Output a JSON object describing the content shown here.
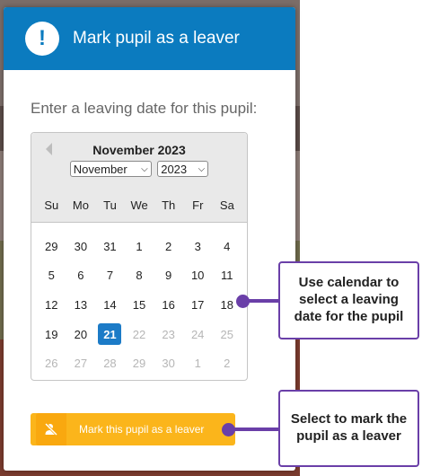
{
  "modal": {
    "title": "Mark pupil as a leaver",
    "alert_icon_glyph": "!",
    "prompt": "Enter a leaving date for this pupil:"
  },
  "datepicker": {
    "title": "November 2023",
    "prev_icon": "chevron-left-icon",
    "month_select": "November",
    "year_select": "2023",
    "weekdays": [
      "Su",
      "Mo",
      "Tu",
      "We",
      "Th",
      "Fr",
      "Sa"
    ],
    "weeks": [
      [
        {
          "d": "29"
        },
        {
          "d": "30"
        },
        {
          "d": "31"
        },
        {
          "d": "1"
        },
        {
          "d": "2"
        },
        {
          "d": "3"
        },
        {
          "d": "4"
        }
      ],
      [
        {
          "d": "5"
        },
        {
          "d": "6"
        },
        {
          "d": "7"
        },
        {
          "d": "8"
        },
        {
          "d": "9"
        },
        {
          "d": "10"
        },
        {
          "d": "11"
        }
      ],
      [
        {
          "d": "12"
        },
        {
          "d": "13"
        },
        {
          "d": "14"
        },
        {
          "d": "15"
        },
        {
          "d": "16"
        },
        {
          "d": "17"
        },
        {
          "d": "18"
        }
      ],
      [
        {
          "d": "19"
        },
        {
          "d": "20"
        },
        {
          "d": "21",
          "selected": true
        },
        {
          "d": "22",
          "muted": true
        },
        {
          "d": "23",
          "muted": true
        },
        {
          "d": "24",
          "muted": true
        },
        {
          "d": "25",
          "muted": true
        }
      ],
      [
        {
          "d": "26",
          "muted": true
        },
        {
          "d": "27",
          "muted": true
        },
        {
          "d": "28",
          "muted": true
        },
        {
          "d": "29",
          "muted": true
        },
        {
          "d": "30",
          "muted": true
        },
        {
          "d": "1",
          "muted": true
        },
        {
          "d": "2",
          "muted": true
        }
      ]
    ]
  },
  "leaver_button": {
    "label": "Mark this pupil as a leaver",
    "icon": "user-slash-icon"
  },
  "annotations": {
    "calendar": "Use calendar to select a leaving date for the pupil",
    "button": "Select to mark the pupil as a leaver"
  },
  "colors": {
    "header_blue": "#0b7bbf",
    "selected_day": "#1c7bc7",
    "button_amber": "#fbb51b",
    "annotation_purple": "#6a3fa8"
  }
}
